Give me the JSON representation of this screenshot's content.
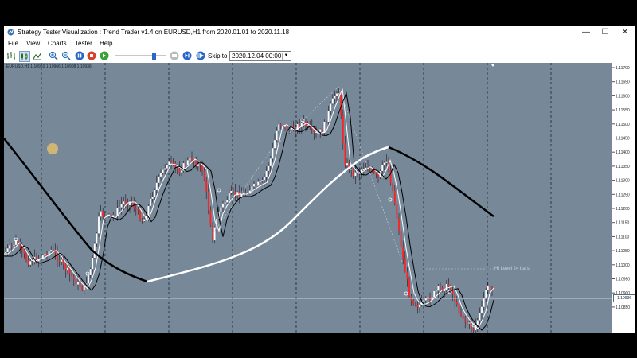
{
  "window": {
    "title": "Strategy Tester Visualization : Trend Trader v1.4 on EURUSD,H1 from 2020.01.01 to 2020.11.18",
    "minimize": "—",
    "maximize": "☐",
    "close": "✕"
  },
  "menu": [
    "File",
    "View",
    "Charts",
    "Tester",
    "Help"
  ],
  "toolbar": {
    "skip_label": "Skip to",
    "skip_value": "2020.12.04 00:00",
    "speed_fraction": 0.8
  },
  "chart": {
    "symbol_info": "EURUSD,H1  1.10960 1.10966 1.10908 1.10936",
    "hi_level_label": "HI Level 24 bars",
    "current_price": "1.10936",
    "price_labels": [
      "1.11700",
      "1.11650",
      "1.11600",
      "1.11550",
      "1.11500",
      "1.11450",
      "1.11400",
      "1.11350",
      "1.11300",
      "1.11250",
      "1.11200",
      "1.11150",
      "1.11100",
      "1.11050",
      "1.11000",
      "1.10950",
      "1.10900",
      "1.10850"
    ],
    "colors": {
      "background": "#778899",
      "bull": "#ffffff",
      "bear": "#ff2020",
      "fast_ma": "#000000",
      "slow_ma": "#ffffff"
    }
  }
}
